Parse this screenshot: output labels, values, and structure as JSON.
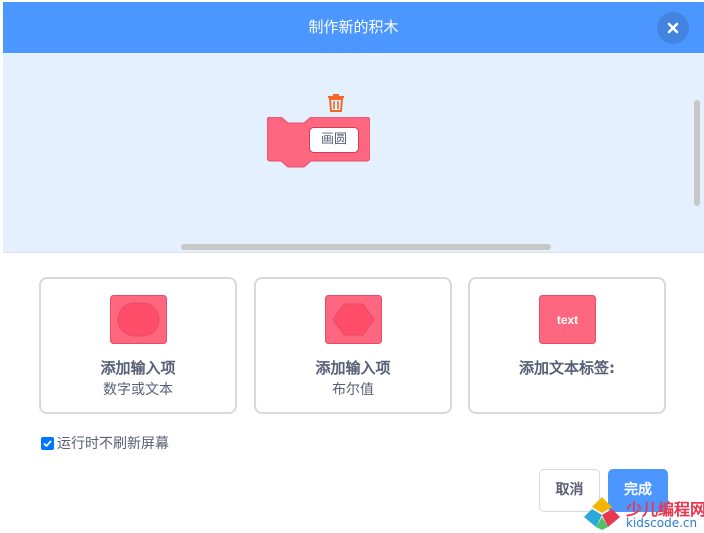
{
  "dialog": {
    "title": "制作新的积木",
    "close_icon": "close-icon",
    "header_color": "#4c97ff"
  },
  "workspace": {
    "block_color": "#ff6680",
    "block_input_text": "画圆",
    "delete_icon": "trash-icon"
  },
  "options": [
    {
      "title": "添加输入项",
      "subtitle": "数字或文本",
      "icon": "round-input-icon"
    },
    {
      "title": "添加输入项",
      "subtitle": "布尔值",
      "icon": "boolean-input-icon"
    },
    {
      "title": "添加文本标签:",
      "subtitle": "",
      "icon": "text-label-icon",
      "icon_text": "text"
    }
  ],
  "run_without_refresh": {
    "label": "运行时不刷新屏幕",
    "checked": true
  },
  "buttons": {
    "cancel": "取消",
    "ok": "完成"
  },
  "watermark": {
    "title": "少儿编程网",
    "url": "kidscode.cn"
  }
}
